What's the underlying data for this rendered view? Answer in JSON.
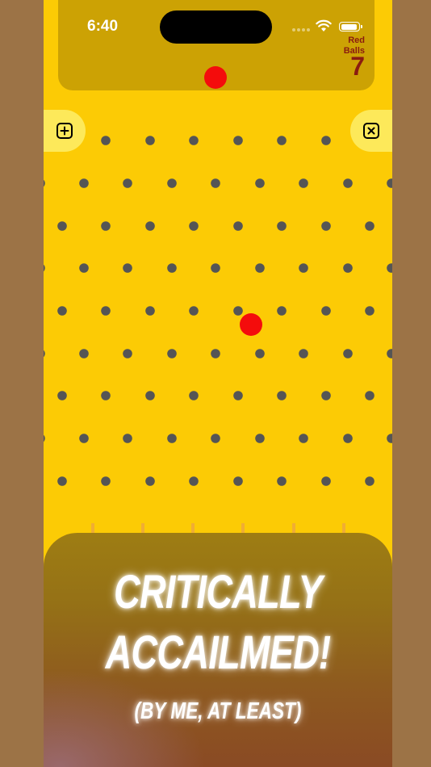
{
  "status_bar": {
    "time": "6:40"
  },
  "counter": {
    "label_line1": "Red",
    "label_line2": "Balls",
    "value": "7"
  },
  "buttons": {
    "add_icon": "plus-square-icon",
    "close_icon": "x-square-icon"
  },
  "colors": {
    "board": "#fccb05",
    "top_panel": "#cca204",
    "peg": "#555555",
    "ball": "#f40c0c",
    "button_bg": "#fde95a",
    "outer": "#9c7346"
  },
  "promo": {
    "line1": "Critically",
    "line2": "Accailmed!",
    "line3": "(By me, at least)"
  }
}
